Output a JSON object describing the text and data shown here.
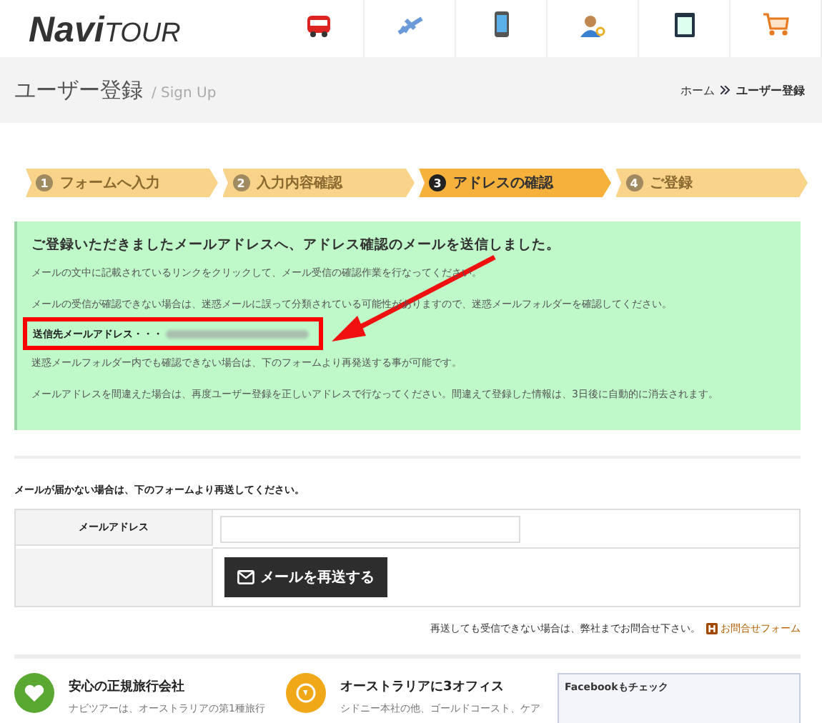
{
  "logo": {
    "bold": "Navi",
    "light": "TOUR"
  },
  "page_title": {
    "title": "ユーザー登録",
    "subtitle": "/ Sign Up"
  },
  "breadcrumb": [
    {
      "label": "ホーム",
      "current": false
    },
    {
      "label": "ユーザー登録",
      "current": true
    }
  ],
  "steps": [
    {
      "number": "1",
      "label": "フォームへ入力",
      "selected": false
    },
    {
      "number": "2",
      "label": "入力内容確認",
      "selected": false
    },
    {
      "number": "3",
      "label": "アドレスの確認",
      "selected": true
    },
    {
      "number": "4",
      "label": "ご登録",
      "selected": false
    }
  ],
  "notice": {
    "heading": "ご登録いただきましたメールアドレスへ、アドレス確認のメールを送信しました。",
    "lines": [
      "メールの文中に記載されているリンクをクリックして、メール受信の確認作業を行なってください。",
      "メールの受信が確認できない場合は、迷惑メールに誤って分類されている可能性がありますので、迷惑メールフォルダーを確認してください。"
    ],
    "address_label": "送信先メールアドレス・・・",
    "after_lines": [
      "迷惑メールフォルダー内でも確認できない場合は、下のフォームより再発送する事が可能です。",
      "メールアドレスを間違えた場合は、再度ユーザー登録を正しいアドレスで行なってください。間違えて登録した情報は、3日後に自動的に消去されます。"
    ]
  },
  "resend": {
    "intro": "メールが届かない場合は、下のフォームより再送してください。",
    "field_label": "メールアドレス",
    "button": "メールを再送する",
    "footnote": "再送しても受信できない場合は、弊社までお問合せ下さい。",
    "contact_link": "お問合せフォーム"
  },
  "features": [
    {
      "kind": "heart",
      "color": "#5aa832",
      "title": "安心の正規旅行会社",
      "text": "ナビツアーは、オーストラリアの第1種旅行"
    },
    {
      "kind": "globe",
      "color": "#f0a818",
      "title": "オーストラリアに3オフィス",
      "text": "シドニー本社の他、ゴールドコースト、ケア"
    }
  ],
  "facebook": {
    "title": "Facebookもチェック"
  }
}
